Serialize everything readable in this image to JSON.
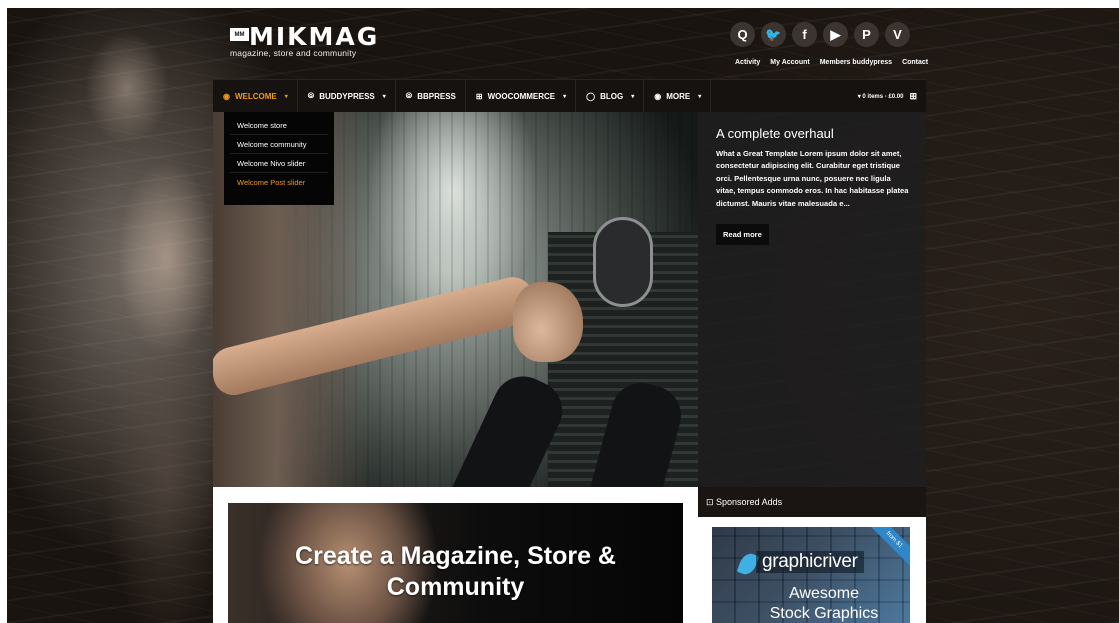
{
  "header": {
    "logo_badge": "MM",
    "logo_text": "MIKMAG",
    "tagline": "magazine, store and community",
    "social": [
      "Q",
      "🐦",
      "f",
      "▶",
      "P",
      "V"
    ],
    "top_links": [
      "Activity",
      "My Account",
      "Members buddypress",
      "Contact"
    ]
  },
  "nav": {
    "items": [
      {
        "icon": "◉",
        "label": "WELCOME",
        "caret": "▾"
      },
      {
        "icon": "⦾",
        "label": "BUDDYPRESS",
        "caret": "▾"
      },
      {
        "icon": "⦾",
        "label": "BBPRESS",
        "caret": ""
      },
      {
        "icon": "⊞",
        "label": "WOOCOMMERCE",
        "caret": "▾"
      },
      {
        "icon": "◯",
        "label": "BLOG",
        "caret": "▾"
      },
      {
        "icon": "◉",
        "label": "MORE",
        "caret": "▾"
      }
    ],
    "cart_text": "▾ 0 items - £0.00",
    "cart_icon": "⊞"
  },
  "dropdown": {
    "items": [
      "Welcome store",
      "Welcome community",
      "Welcome Nivo slider",
      "Welcome Post slider"
    ]
  },
  "slider": {
    "title": "A complete overhaul",
    "text": "What a Great Template Lorem ipsum dolor sit amet, consectetur adipiscing elit. Curabitur eget tristique orci. Pellentesque urna nunc, posuere nec ligula vitae, tempus commodo eros. In hac habitasse platea dictumst. Mauris vitae malesuada e...",
    "button": "Read more"
  },
  "promo": {
    "title_line1": "Create a Magazine, Store &",
    "title_line2": "Community"
  },
  "sidebar": {
    "sponsored_title": "⊡ Sponsored Adds",
    "ad_brand": "graphicriver",
    "ad_line1": "Awesome",
    "ad_line2": "Stock Graphics",
    "ad_ribbon": "from $1"
  },
  "colors": {
    "accent": "#f09a1a",
    "nav_bg": "#151210",
    "caption_bg": "#1e1e20"
  }
}
